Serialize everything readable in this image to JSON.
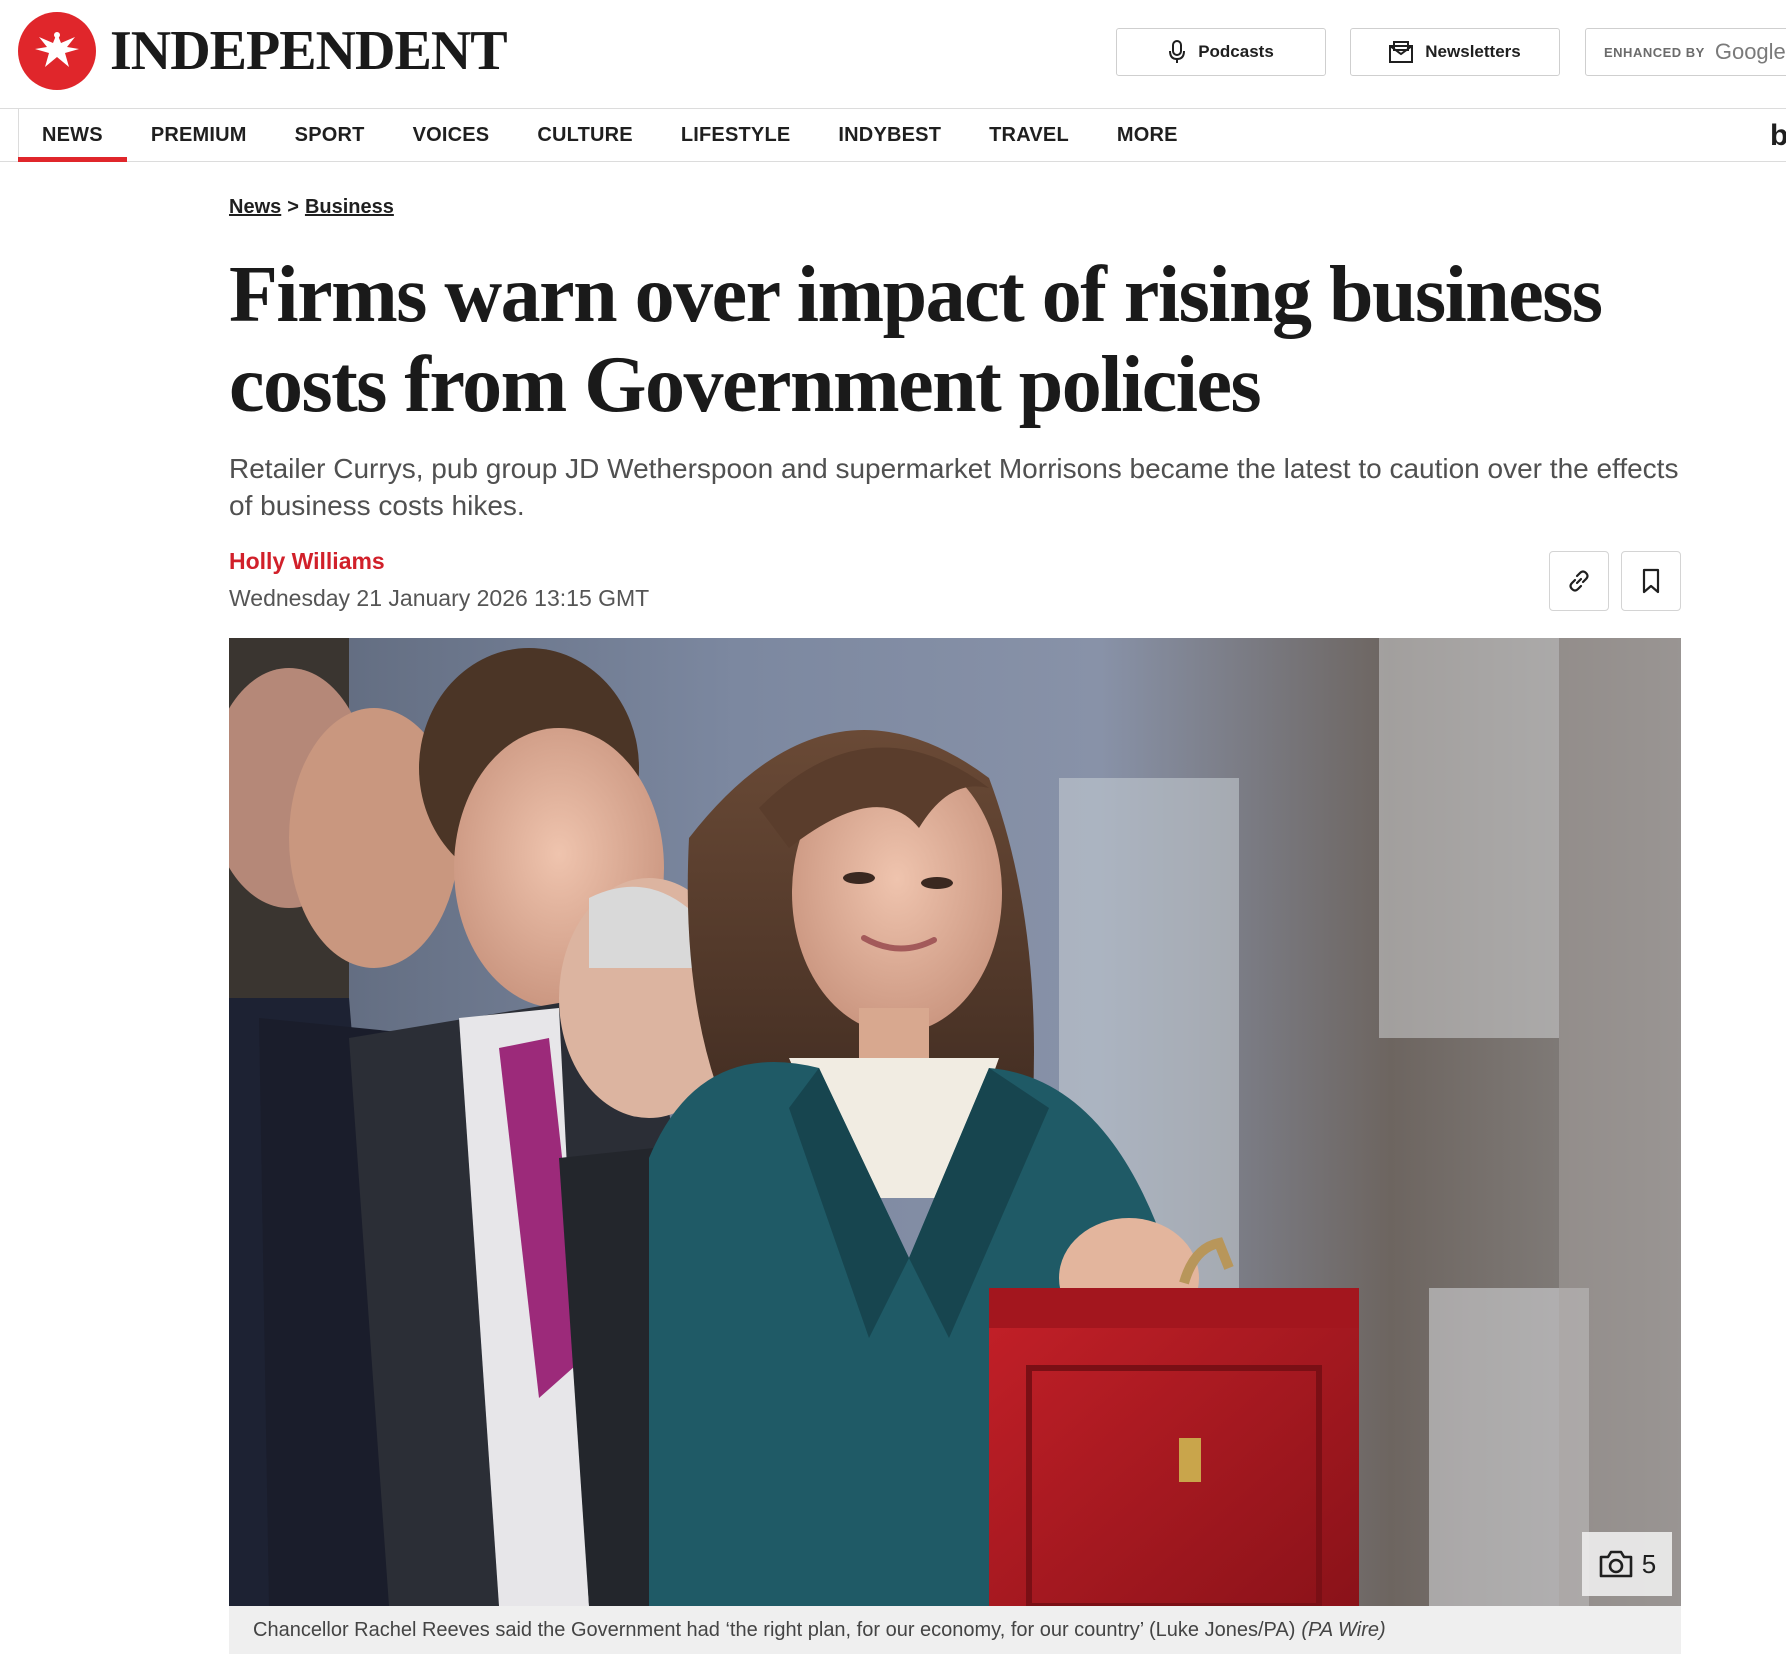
{
  "header": {
    "logo_text": "INDEPENDENT",
    "podcasts_label": "Podcasts",
    "newsletters_label": "Newsletters",
    "search_enhanced_label": "ENHANCED BY",
    "search_brand": "Google"
  },
  "nav": {
    "items": [
      {
        "label": "NEWS",
        "active": true
      },
      {
        "label": "PREMIUM"
      },
      {
        "label": "SPORT"
      },
      {
        "label": "VOICES"
      },
      {
        "label": "CULTURE"
      },
      {
        "label": "LIFESTYLE"
      },
      {
        "label": "INDYBEST"
      },
      {
        "label": "TRAVEL"
      },
      {
        "label": "MORE"
      }
    ],
    "right_glyph": "b"
  },
  "breadcrumb": {
    "items": [
      "News",
      "Business"
    ],
    "separator": ">"
  },
  "article": {
    "headline": "Firms warn over impact of rising business costs from Government policies",
    "standfirst": "Retailer Currys, pub group JD Wetherspoon and supermarket Morrisons became the latest to caution over the effects of business costs hikes.",
    "author": "Holly Williams",
    "date": "Wednesday 21 January 2026 13:15 GMT",
    "gallery_count": "5",
    "caption": "Chancellor Rachel Reeves said the Government had ‘the right plan, for our economy, for our country’ (Luke Jones/PA)",
    "caption_credit": "(PA Wire)"
  },
  "colors": {
    "brand_red": "#e0262b",
    "author_red": "#d1202a",
    "budget_box": "#b01a22",
    "jacket_teal": "#1f5a66"
  }
}
